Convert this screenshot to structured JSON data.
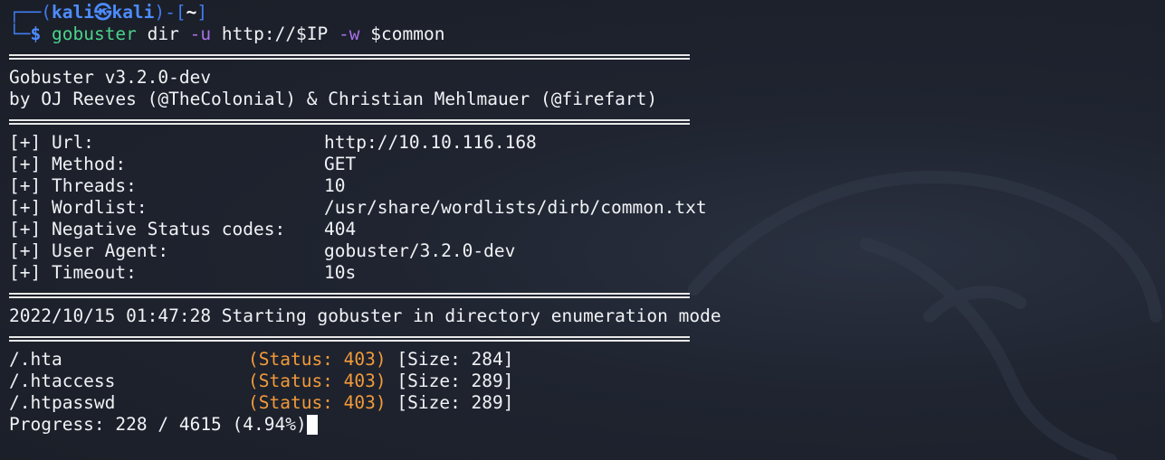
{
  "prompt": {
    "open": "┌──(",
    "user": "kali",
    "at_symbol": "㉿",
    "host": "kali",
    "mid": ")-[",
    "cwd": "~",
    "close": "]",
    "corner": "└─",
    "dollar": "$",
    "command": "gobuster",
    "arg1": "dir",
    "flag_u": "-u",
    "url": "http://$IP",
    "flag_w": "-w",
    "wordlist_var": "$common"
  },
  "banner": {
    "title": "Gobuster v3.2.0-dev",
    "authors": "by OJ Reeves (@TheColonial) & Christian Mehlmauer (@firefart)"
  },
  "config": [
    {
      "label": "[+] Url:",
      "value": "http://10.10.116.168"
    },
    {
      "label": "[+] Method:",
      "value": "GET"
    },
    {
      "label": "[+] Threads:",
      "value": "10"
    },
    {
      "label": "[+] Wordlist:",
      "value": "/usr/share/wordlists/dirb/common.txt"
    },
    {
      "label": "[+] Negative Status codes:",
      "value": "404"
    },
    {
      "label": "[+] User Agent:",
      "value": "gobuster/3.2.0-dev"
    },
    {
      "label": "[+] Timeout:",
      "value": "10s"
    }
  ],
  "start_message": "2022/10/15 01:47:28 Starting gobuster in directory enumeration mode",
  "results": [
    {
      "path": "/.hta",
      "status": "(Status: 403)",
      "size": "[Size: 284]"
    },
    {
      "path": "/.htaccess",
      "status": "(Status: 403)",
      "size": "[Size: 289]"
    },
    {
      "path": "/.htpasswd",
      "status": "(Status: 403)",
      "size": "[Size: 289]"
    }
  ],
  "progress": "Progress: 228 / 4615 (4.94%)",
  "colors": {
    "background": "#1f2430",
    "prompt_blue": "#4d8cff",
    "command_green": "#4bd38a",
    "flag_purple": "#a872e8",
    "status_orange": "#f29a3a"
  }
}
